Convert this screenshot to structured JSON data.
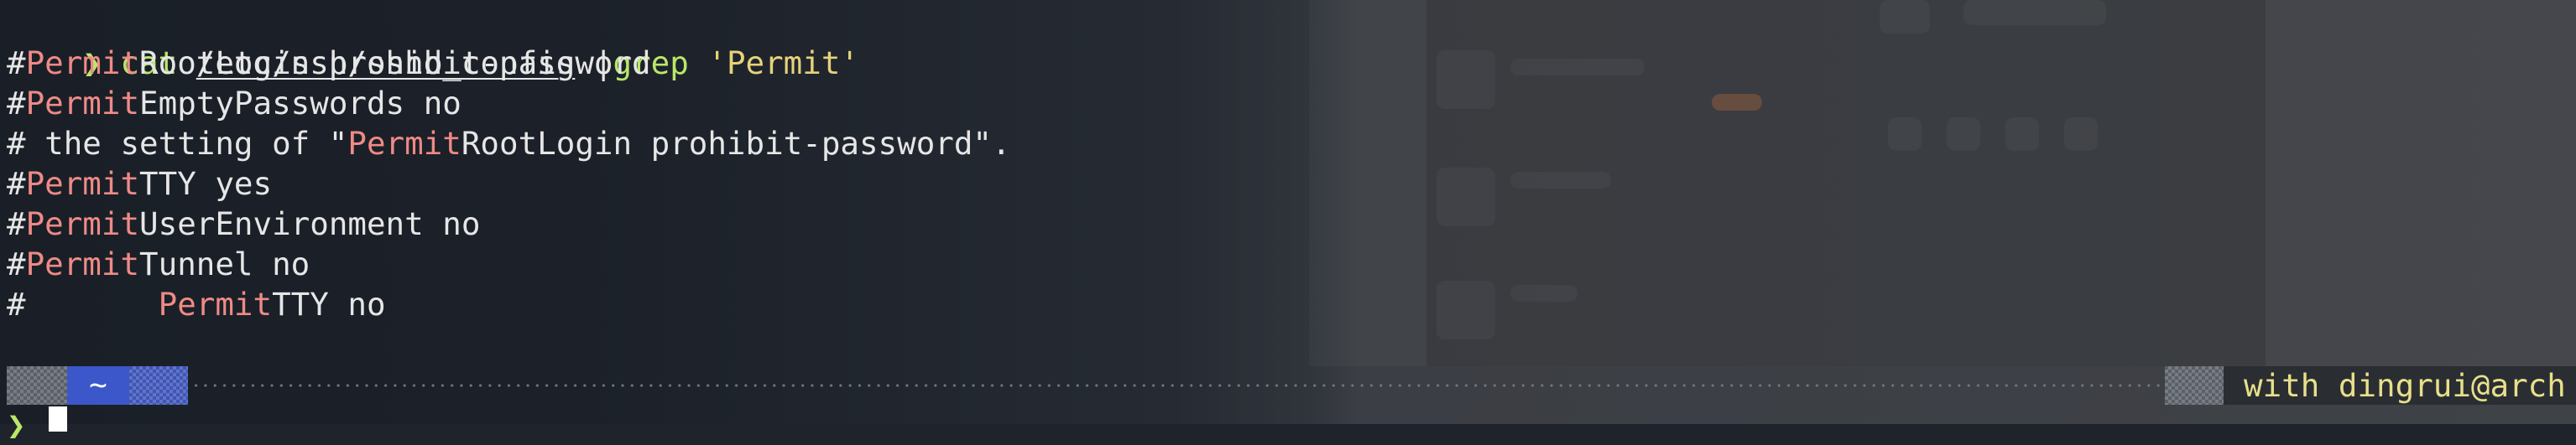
{
  "terminal": {
    "prompt_symbol": "❯",
    "command": {
      "name": "cat",
      "path": "/etc/ssh/sshd_config",
      "pipe": "|",
      "filter_cmd": "grep",
      "pattern": "'Permit'"
    },
    "output": [
      {
        "before": "#",
        "match": "Permit",
        "after": "RootLogin prohibit-password"
      },
      {
        "before": "#",
        "match": "Permit",
        "after": "EmptyPasswords no"
      },
      {
        "before": "# the setting of \"",
        "match": "Permit",
        "after": "RootLogin prohibit-password\"."
      },
      {
        "before": "#",
        "match": "Permit",
        "after": "TTY yes"
      },
      {
        "before": "#",
        "match": "Permit",
        "after": "UserEnvironment no"
      },
      {
        "before": "#",
        "match": "Permit",
        "after": "Tunnel no"
      },
      {
        "before": "#       ",
        "match": "Permit",
        "after": "TTY no"
      }
    ]
  },
  "statusbar": {
    "directory": "~",
    "right_text": "with dingrui@arch"
  },
  "colors": {
    "prompt": "#b9e76a",
    "match_highlight": "#ef8a86",
    "string": "#e6d27a",
    "dir_segment": "#3b57c9"
  }
}
